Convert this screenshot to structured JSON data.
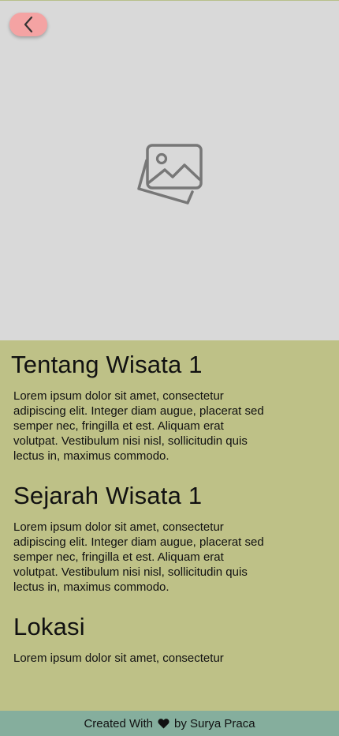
{
  "hero": {
    "image_placeholder_icon": "image-placeholder-icon",
    "back_icon": "chevron-left-icon",
    "back_button_color": "#f4a3a3",
    "background": "#d9d9d9"
  },
  "sections": [
    {
      "title": "Tentang Wisata 1",
      "lines": [
        "Lorem ipsum dolor sit amet, consectetur",
        "adipiscing elit. Integer diam augue, placerat sed",
        "semper nec, fringilla et est. Aliquam erat",
        "volutpat. Vestibulum nisi nisl, sollicitudin quis",
        "lectus in, maximus commodo."
      ]
    },
    {
      "title": "Sejarah Wisata 1",
      "lines": [
        "Lorem ipsum dolor sit amet, consectetur",
        "adipiscing elit. Integer diam augue, placerat sed",
        "semper nec, fringilla et est. Aliquam erat",
        "volutpat. Vestibulum nisi nisl, sollicitudin quis",
        "lectus in, maximus commodo."
      ]
    },
    {
      "title": "Lokasi",
      "lines": [
        "Lorem ipsum dolor sit amet, consectetur"
      ]
    }
  ],
  "footer": {
    "prefix": "Created With",
    "suffix": "by Surya Praca",
    "heart_icon": "heart-icon",
    "background": "#85ae9d"
  },
  "colors": {
    "content_background": "#bec187"
  }
}
